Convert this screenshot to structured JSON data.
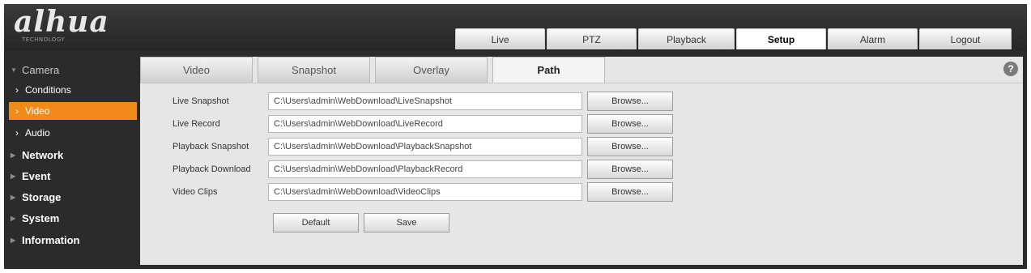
{
  "brand": {
    "logo": "alhua",
    "tagline": "TECHNOLOGY"
  },
  "topnav": {
    "tabs": [
      {
        "label": "Live"
      },
      {
        "label": "PTZ"
      },
      {
        "label": "Playback"
      },
      {
        "label": "Setup",
        "active": true
      },
      {
        "label": "Alarm"
      },
      {
        "label": "Logout"
      }
    ]
  },
  "sidebar": {
    "camera": "Camera",
    "conditions": "Conditions",
    "video": "Video",
    "audio": "Audio",
    "network": "Network",
    "event": "Event",
    "storage": "Storage",
    "system": "System",
    "information": "Information"
  },
  "content_tabs": {
    "video": "Video",
    "snapshot": "Snapshot",
    "overlay": "Overlay",
    "path": "Path",
    "active": "Path"
  },
  "help_icon": "?",
  "paths": [
    {
      "label": "Live Snapshot",
      "value": "C:\\Users\\admin\\WebDownload\\LiveSnapshot",
      "button": "Browse..."
    },
    {
      "label": "Live Record",
      "value": "C:\\Users\\admin\\WebDownload\\LiveRecord",
      "button": "Browse..."
    },
    {
      "label": "Playback Snapshot",
      "value": "C:\\Users\\admin\\WebDownload\\PlaybackSnapshot",
      "button": "Browse..."
    },
    {
      "label": "Playback Download",
      "value": "C:\\Users\\admin\\WebDownload\\PlaybackRecord",
      "button": "Browse..."
    },
    {
      "label": "Video Clips",
      "value": "C:\\Users\\admin\\WebDownload\\VideoClips",
      "button": "Browse..."
    }
  ],
  "actions": {
    "default": "Default",
    "save": "Save"
  },
  "colors": {
    "accent": "#f28a19",
    "background": "#2b2b2b",
    "panel": "#e6e6e6"
  }
}
